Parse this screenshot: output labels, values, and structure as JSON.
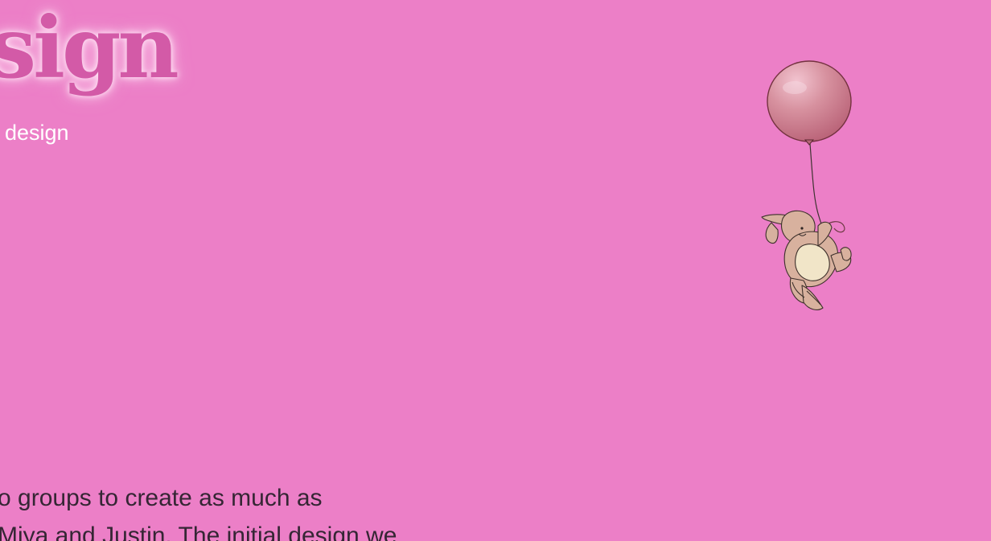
{
  "hero": {
    "title": "sign",
    "subtitle": "design"
  },
  "illustration": {
    "icon": "balloon-bunny-icon",
    "balloon_color": "#c97d97",
    "bunny_color": "#d8b19e"
  },
  "content": {
    "lines": [
      "o groups to create as much as",
      "Miya and Justin. The initial design we"
    ]
  },
  "colors": {
    "background": "#ec7fc7",
    "title": "#d35aa7",
    "subtitle": "#ffffff",
    "body_text": "#352634"
  }
}
